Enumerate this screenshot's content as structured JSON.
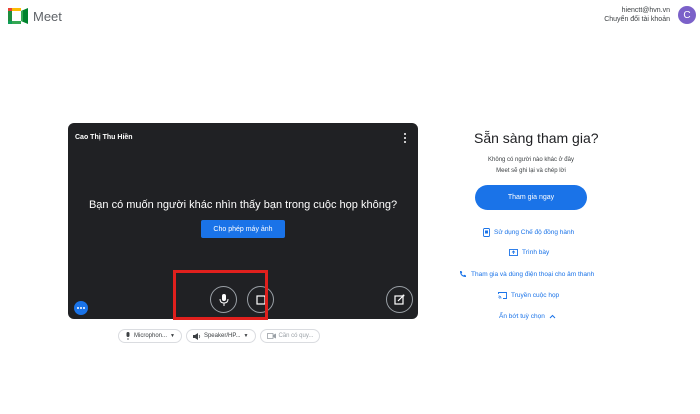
{
  "header": {
    "app_name": "Meet",
    "account_email": "hienctt@hvn.vn",
    "switch_account": "Chuyển đổi tài khoản",
    "avatar_letter": "C"
  },
  "preview": {
    "participant_name": "Cao Thị Thu Hiền",
    "question": "Bạn có muốn người khác nhìn thấy bạn trong cuộc họp không?",
    "allow_button": "Cho phép máy ảnh"
  },
  "devices": {
    "microphone": "Microphon...",
    "speaker": "Speaker/HP...",
    "camera": "Cần có quy..."
  },
  "join": {
    "title": "Sẵn sàng tham gia?",
    "info_line1": "Không có người nào khác ở đây",
    "info_line2": "Meet sẽ ghi lại và chép lời",
    "join_button": "Tham gia ngay",
    "companion_mode": "Sử dụng Chế độ đồng hành",
    "present": "Trình bày",
    "phone_audio": "Tham gia và dùng điện thoại cho âm thanh",
    "cast": "Truyền cuộc họp",
    "hide_options": "Ẩn bớt tuỳ chọn"
  },
  "colors": {
    "accent": "#1a73e8",
    "highlight": "#e0201d",
    "preview_bg": "#202124"
  }
}
